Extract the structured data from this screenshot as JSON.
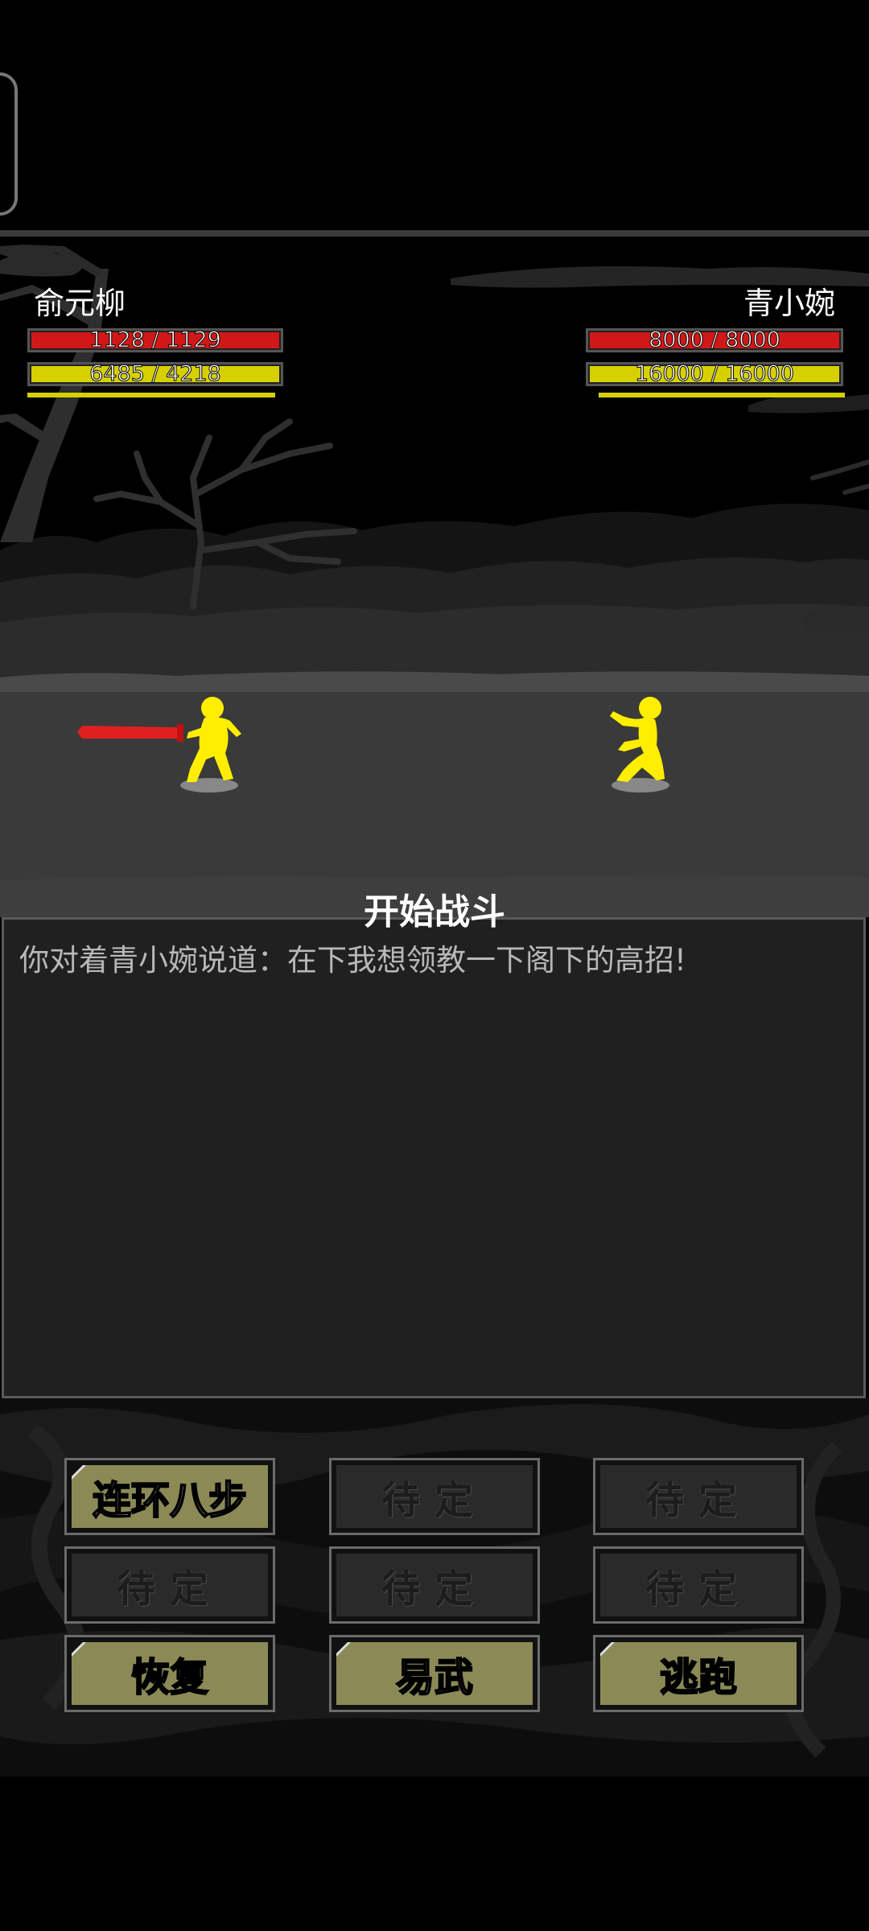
{
  "player": {
    "name": "俞元柳",
    "hp_text": "1128 / 1129",
    "hp_fraction": 0.999,
    "mp_text": "6485 / 4218",
    "mp_fraction": 1.0
  },
  "enemy": {
    "name": "青小婉",
    "hp_text": "8000 / 8000",
    "hp_fraction": 1.0,
    "mp_text": "16000 / 16000",
    "mp_fraction": 1.0
  },
  "log": {
    "title": "开始战斗",
    "lines": [
      "你对着青小婉说道：在下我想领教一下阁下的高招!"
    ]
  },
  "actions": {
    "skill_1": "连环八步",
    "pending": "待定",
    "recover": "恢复",
    "switch_weapon": "易武",
    "flee": "逃跑"
  },
  "colors": {
    "hp": "#d01818",
    "mp": "#d6d000",
    "fighter": "#ffee00",
    "sword": "#e02020",
    "button_active": "#8b8a57"
  }
}
